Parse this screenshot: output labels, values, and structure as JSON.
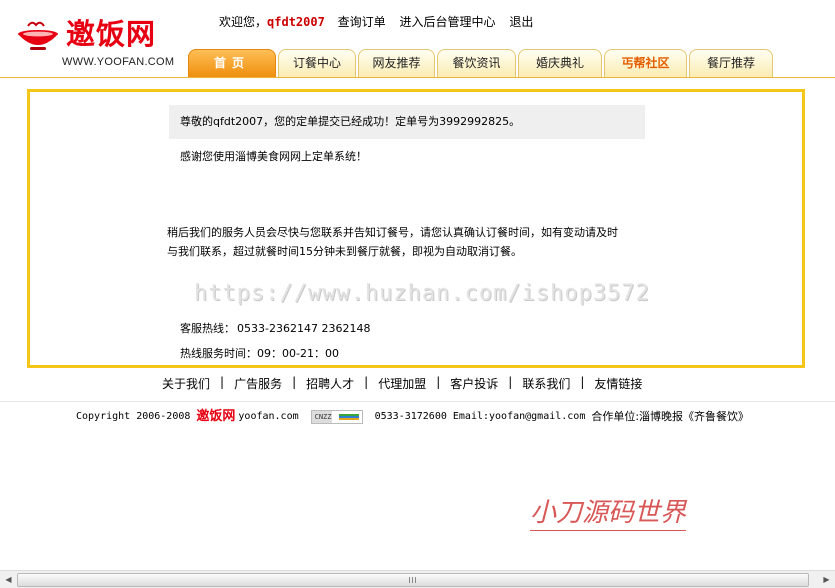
{
  "header": {
    "logo_text": "邀饭网",
    "logo_url": "WWW.YOOFAN.COM",
    "welcome": "欢迎您，",
    "username": "qfdt2007",
    "links": [
      "查询订单",
      "进入后台管理中心",
      "退出"
    ]
  },
  "nav": {
    "tabs": [
      {
        "label": "首页",
        "active": true
      },
      {
        "label": "订餐中心"
      },
      {
        "label": "网友推荐"
      },
      {
        "label": "餐饮资讯"
      },
      {
        "label": "婚庆典礼"
      },
      {
        "label": "丐帮社区",
        "highlight": true
      },
      {
        "label": "餐厅推荐"
      }
    ]
  },
  "main": {
    "success_message": "尊敬的qfdt2007，您的定单提交已经成功！定单号为3992992825。",
    "thanks_message": "感谢您使用淄博美食网网上定单系统！",
    "notice_line1": "稍后我们的服务人员会尽快与您联系并告知订餐号，请您认真确认订餐时间，如有变动请及时",
    "notice_line2": "与我们联系，超过就餐时间15分钟未到餐厅就餐，即视为自动取消订餐。",
    "watermark": "https://www.huzhan.com/ishop3572",
    "hotline_label": "客服热线：",
    "hotline_numbers": "0533-2362147  2362148",
    "hours_label": "热线服务时间：",
    "hours_value": "09：00-21：00"
  },
  "footer": {
    "links": [
      "关于我们",
      "广告服务",
      "招聘人才",
      "代理加盟",
      "客户投诉",
      "联系我们",
      "友情链接"
    ],
    "copyright": "Copyright 2006-2008",
    "brand": "邀饭网",
    "domain": "yoofan.com",
    "cnzz": "CNZZ",
    "contact": "0533-3172600 Email:yoofan@gmail.com",
    "partner": "合作单位:淄博晚报《齐鲁餐饮》"
  },
  "signature": "小刀源码世界",
  "colors": {
    "brand_red": "#e60012",
    "nav_active": "#ee8f0e",
    "box_border": "#f5c518"
  }
}
